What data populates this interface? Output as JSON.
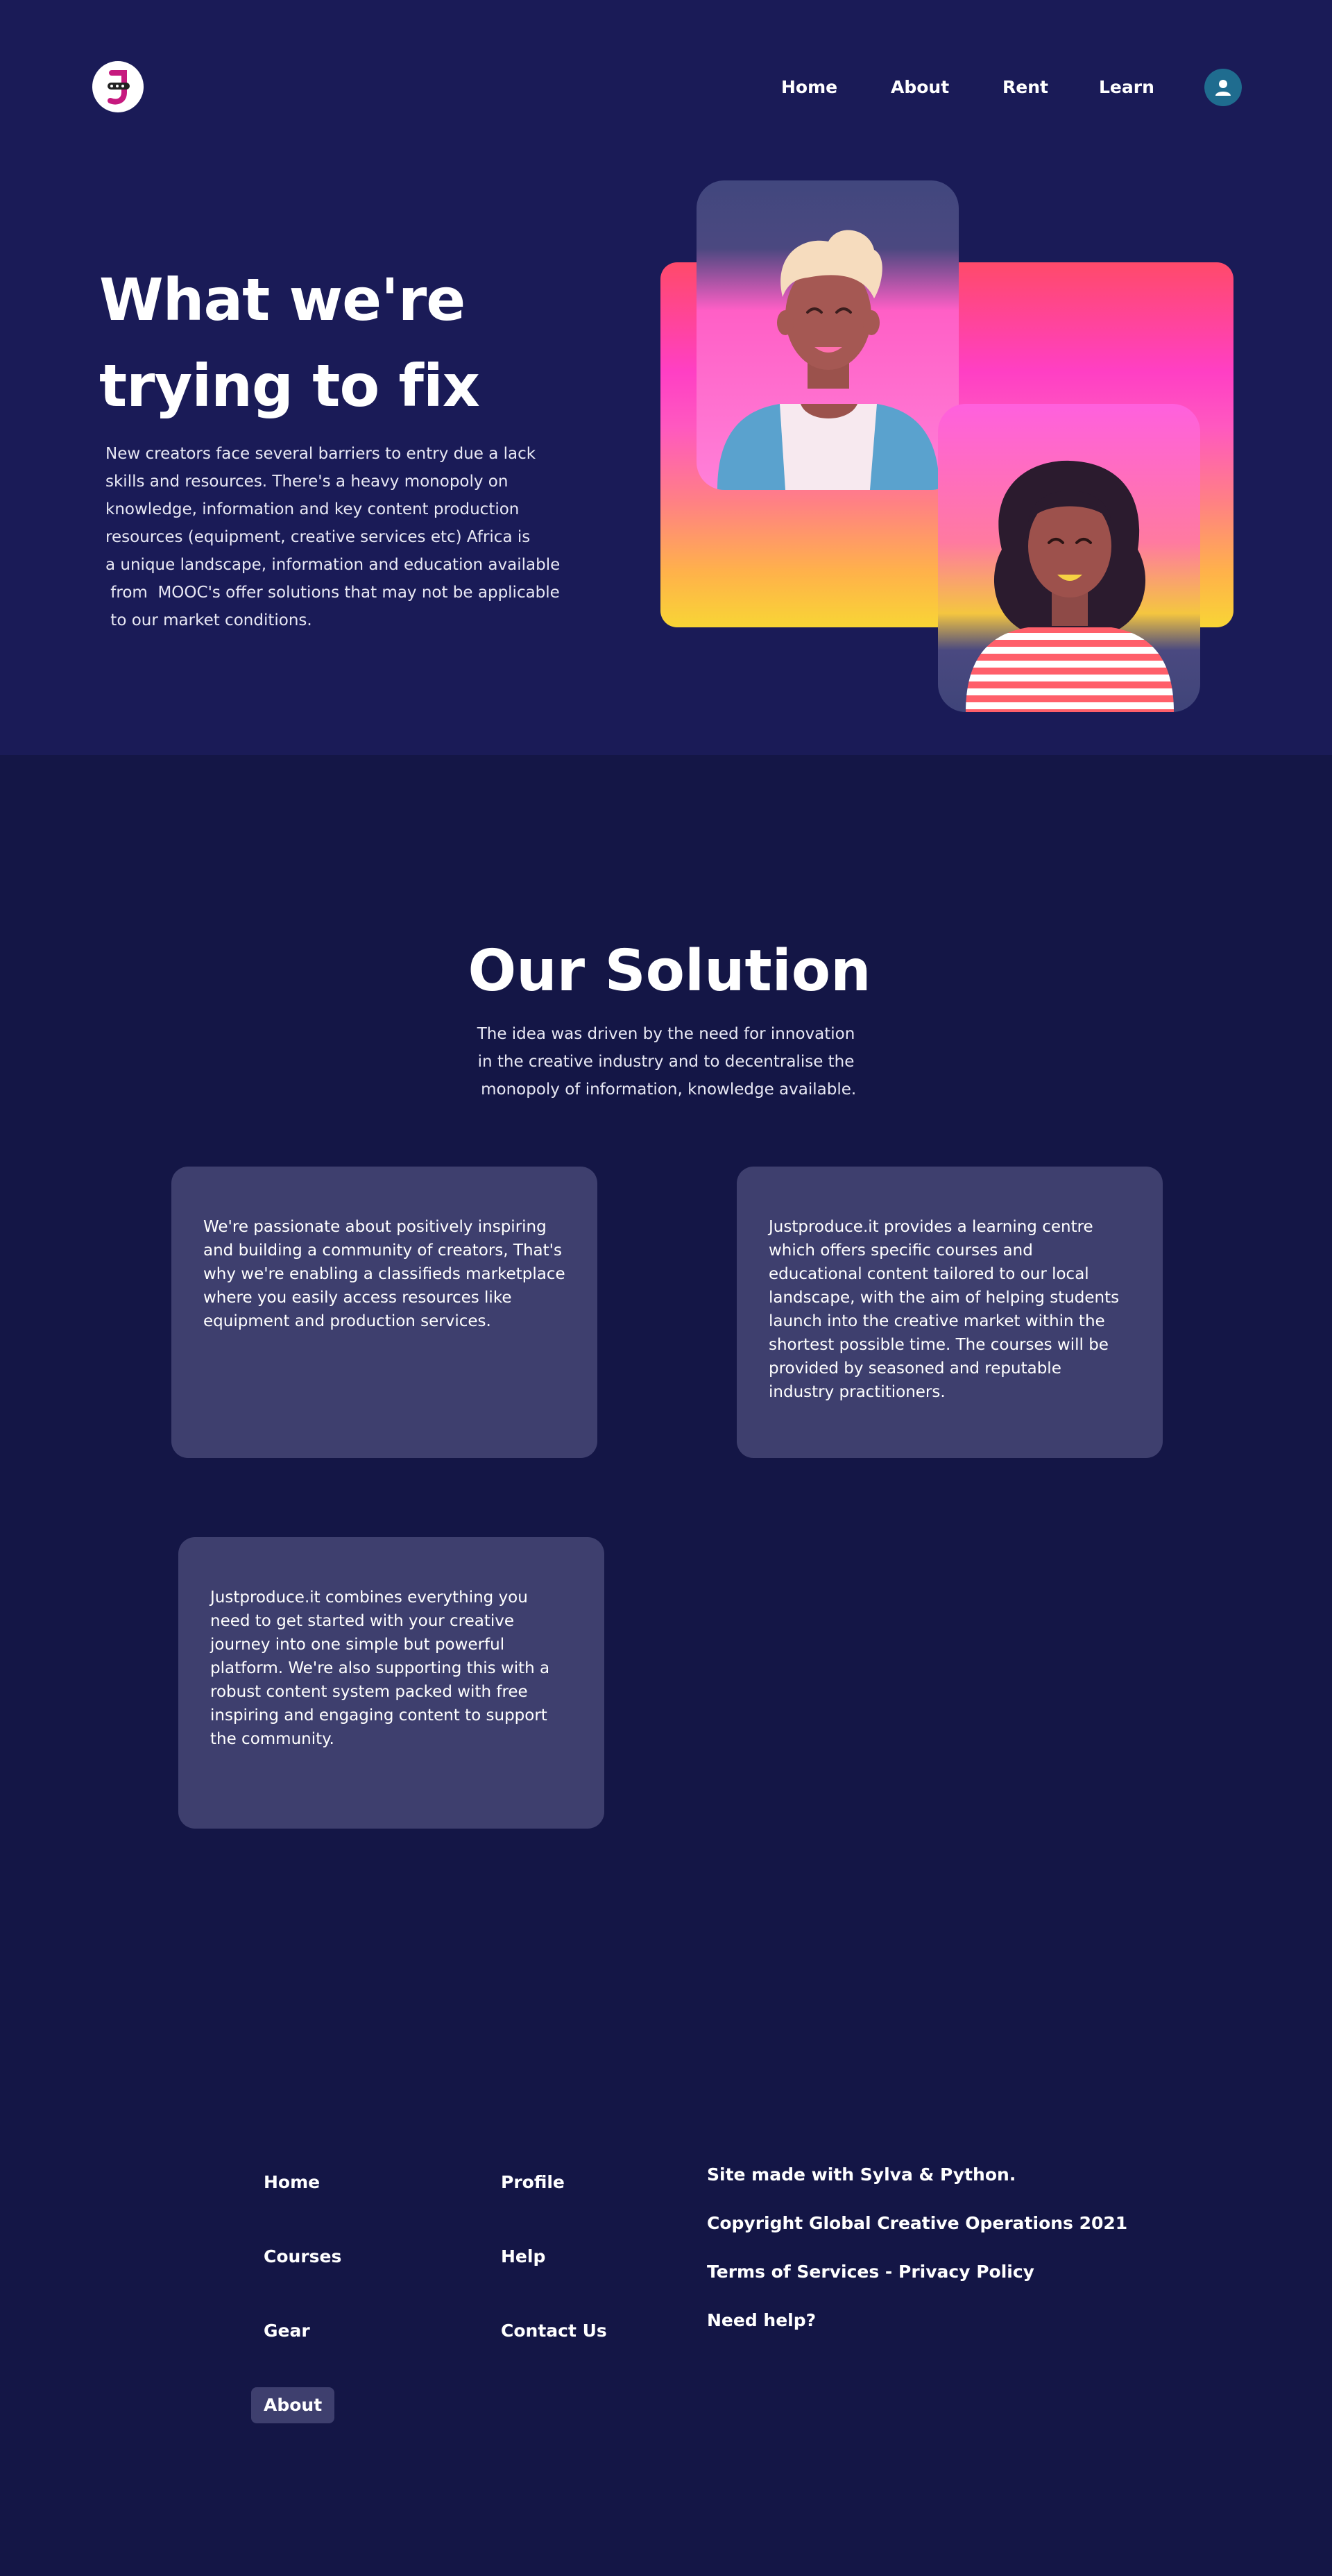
{
  "colors": {
    "hero_bg": "#1a1b57",
    "page_bg": "#141646",
    "card_bg": "#3e3f6e",
    "avatar_bg": "#1f6c8f",
    "logo_accent": "#c6197e"
  },
  "header": {
    "logo_icon": "brand-logo-icon",
    "nav": [
      {
        "label": "Home"
      },
      {
        "label": "About"
      },
      {
        "label": "Rent"
      },
      {
        "label": "Learn"
      }
    ],
    "account_icon": "user-icon"
  },
  "hero": {
    "title_line1": "What we're",
    "title_line2": "trying to fix",
    "body_lines": [
      "New creators face several barriers to entry due a lack",
      "skills and resources. There's a heavy monopoly on",
      "knowledge, information and key content production",
      "resources (equipment, creative services etc) Africa is",
      "a unique landscape, information and education available",
      " from  MOOC's offer solutions that may not be applicable",
      " to our market conditions."
    ]
  },
  "solution": {
    "title": "Our Solution",
    "subtitle_lines": [
      "The idea was driven by the need for innovation",
      "in the creative industry and to decentralise the",
      " monopoly of information, knowledge available."
    ],
    "cards": [
      {
        "text": "We're passionate about positively inspiring and building a community of creators, That's why we're enabling a classifieds marketplace where you easily access resources like equipment and production services."
      },
      {
        "text": "Justproduce.it provides a learning centre which offers specific courses and educational content tailored to our local landscape, with the aim of helping students launch into the creative market within the shortest possible time. The courses will be provided by seasoned and reputable industry practitioners."
      },
      {
        "text": "Justproduce.it combines everything you need to get started with your creative journey into one simple but powerful platform. We're also supporting this with a robust content system packed with free inspiring and engaging content to support the community."
      }
    ]
  },
  "footer": {
    "col1": [
      {
        "label": "Home"
      },
      {
        "label": "Courses"
      },
      {
        "label": "Gear"
      },
      {
        "label": "About"
      }
    ],
    "col2": [
      {
        "label": "Profile"
      },
      {
        "label": "Help"
      },
      {
        "label": "Contact Us"
      }
    ],
    "info": [
      "Site made with Sylva & Python.",
      "Copyright Global Creative Operations 2021",
      "Terms of Services - Privacy Policy",
      "Need help?"
    ]
  }
}
